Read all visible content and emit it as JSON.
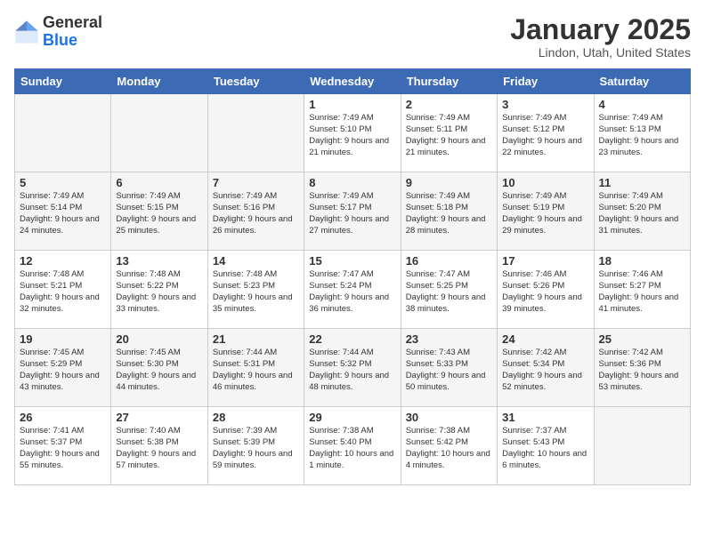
{
  "header": {
    "logo_general": "General",
    "logo_blue": "Blue",
    "month_title": "January 2025",
    "location": "Lindon, Utah, United States"
  },
  "weekdays": [
    "Sunday",
    "Monday",
    "Tuesday",
    "Wednesday",
    "Thursday",
    "Friday",
    "Saturday"
  ],
  "weeks": [
    [
      {
        "day": "",
        "info": ""
      },
      {
        "day": "",
        "info": ""
      },
      {
        "day": "",
        "info": ""
      },
      {
        "day": "1",
        "info": "Sunrise: 7:49 AM\nSunset: 5:10 PM\nDaylight: 9 hours and 21 minutes."
      },
      {
        "day": "2",
        "info": "Sunrise: 7:49 AM\nSunset: 5:11 PM\nDaylight: 9 hours and 21 minutes."
      },
      {
        "day": "3",
        "info": "Sunrise: 7:49 AM\nSunset: 5:12 PM\nDaylight: 9 hours and 22 minutes."
      },
      {
        "day": "4",
        "info": "Sunrise: 7:49 AM\nSunset: 5:13 PM\nDaylight: 9 hours and 23 minutes."
      }
    ],
    [
      {
        "day": "5",
        "info": "Sunrise: 7:49 AM\nSunset: 5:14 PM\nDaylight: 9 hours and 24 minutes."
      },
      {
        "day": "6",
        "info": "Sunrise: 7:49 AM\nSunset: 5:15 PM\nDaylight: 9 hours and 25 minutes."
      },
      {
        "day": "7",
        "info": "Sunrise: 7:49 AM\nSunset: 5:16 PM\nDaylight: 9 hours and 26 minutes."
      },
      {
        "day": "8",
        "info": "Sunrise: 7:49 AM\nSunset: 5:17 PM\nDaylight: 9 hours and 27 minutes."
      },
      {
        "day": "9",
        "info": "Sunrise: 7:49 AM\nSunset: 5:18 PM\nDaylight: 9 hours and 28 minutes."
      },
      {
        "day": "10",
        "info": "Sunrise: 7:49 AM\nSunset: 5:19 PM\nDaylight: 9 hours and 29 minutes."
      },
      {
        "day": "11",
        "info": "Sunrise: 7:49 AM\nSunset: 5:20 PM\nDaylight: 9 hours and 31 minutes."
      }
    ],
    [
      {
        "day": "12",
        "info": "Sunrise: 7:48 AM\nSunset: 5:21 PM\nDaylight: 9 hours and 32 minutes."
      },
      {
        "day": "13",
        "info": "Sunrise: 7:48 AM\nSunset: 5:22 PM\nDaylight: 9 hours and 33 minutes."
      },
      {
        "day": "14",
        "info": "Sunrise: 7:48 AM\nSunset: 5:23 PM\nDaylight: 9 hours and 35 minutes."
      },
      {
        "day": "15",
        "info": "Sunrise: 7:47 AM\nSunset: 5:24 PM\nDaylight: 9 hours and 36 minutes."
      },
      {
        "day": "16",
        "info": "Sunrise: 7:47 AM\nSunset: 5:25 PM\nDaylight: 9 hours and 38 minutes."
      },
      {
        "day": "17",
        "info": "Sunrise: 7:46 AM\nSunset: 5:26 PM\nDaylight: 9 hours and 39 minutes."
      },
      {
        "day": "18",
        "info": "Sunrise: 7:46 AM\nSunset: 5:27 PM\nDaylight: 9 hours and 41 minutes."
      }
    ],
    [
      {
        "day": "19",
        "info": "Sunrise: 7:45 AM\nSunset: 5:29 PM\nDaylight: 9 hours and 43 minutes."
      },
      {
        "day": "20",
        "info": "Sunrise: 7:45 AM\nSunset: 5:30 PM\nDaylight: 9 hours and 44 minutes."
      },
      {
        "day": "21",
        "info": "Sunrise: 7:44 AM\nSunset: 5:31 PM\nDaylight: 9 hours and 46 minutes."
      },
      {
        "day": "22",
        "info": "Sunrise: 7:44 AM\nSunset: 5:32 PM\nDaylight: 9 hours and 48 minutes."
      },
      {
        "day": "23",
        "info": "Sunrise: 7:43 AM\nSunset: 5:33 PM\nDaylight: 9 hours and 50 minutes."
      },
      {
        "day": "24",
        "info": "Sunrise: 7:42 AM\nSunset: 5:34 PM\nDaylight: 9 hours and 52 minutes."
      },
      {
        "day": "25",
        "info": "Sunrise: 7:42 AM\nSunset: 5:36 PM\nDaylight: 9 hours and 53 minutes."
      }
    ],
    [
      {
        "day": "26",
        "info": "Sunrise: 7:41 AM\nSunset: 5:37 PM\nDaylight: 9 hours and 55 minutes."
      },
      {
        "day": "27",
        "info": "Sunrise: 7:40 AM\nSunset: 5:38 PM\nDaylight: 9 hours and 57 minutes."
      },
      {
        "day": "28",
        "info": "Sunrise: 7:39 AM\nSunset: 5:39 PM\nDaylight: 9 hours and 59 minutes."
      },
      {
        "day": "29",
        "info": "Sunrise: 7:38 AM\nSunset: 5:40 PM\nDaylight: 10 hours and 1 minute."
      },
      {
        "day": "30",
        "info": "Sunrise: 7:38 AM\nSunset: 5:42 PM\nDaylight: 10 hours and 4 minutes."
      },
      {
        "day": "31",
        "info": "Sunrise: 7:37 AM\nSunset: 5:43 PM\nDaylight: 10 hours and 6 minutes."
      },
      {
        "day": "",
        "info": ""
      }
    ]
  ]
}
